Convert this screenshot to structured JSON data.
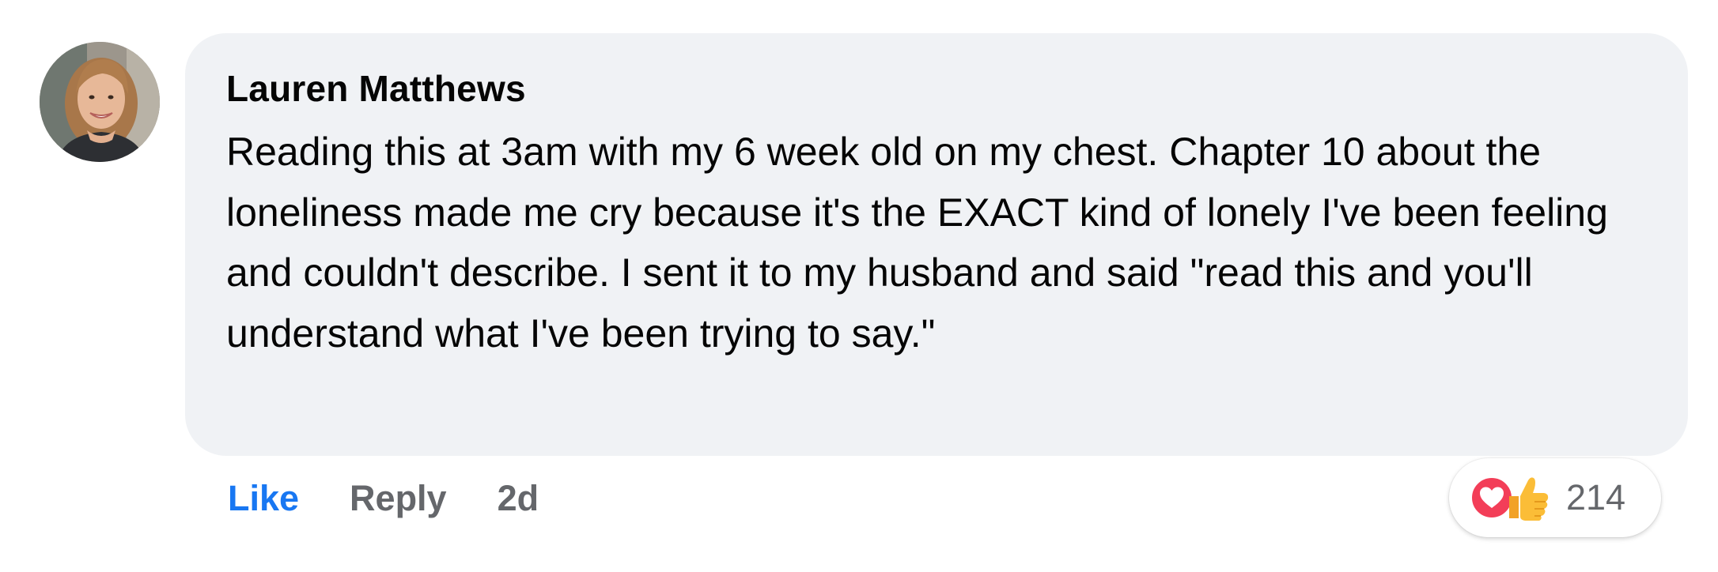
{
  "comment": {
    "author": "Lauren Matthews",
    "text": "Reading this at 3am with my 6 week old on my chest. Chapter 10 about the loneliness made me cry because it's the EXACT kind of lonely I've been feeling and couldn't describe. I sent it to my husband and said \"read this and you'll understand what I've been trying to say.\"",
    "avatar_icon": "user-photo-avatar"
  },
  "actions": {
    "like_label": "Like",
    "reply_label": "Reply",
    "timestamp": "2d"
  },
  "reactions": {
    "icons": [
      "heart-reaction-icon",
      "thumbs-up-reaction-icon"
    ],
    "count": "214"
  },
  "colors": {
    "bubble_bg": "#f0f2f5",
    "like_blue": "#1877f2",
    "secondary_text": "#65676b",
    "heart_red": "#f33e58"
  }
}
